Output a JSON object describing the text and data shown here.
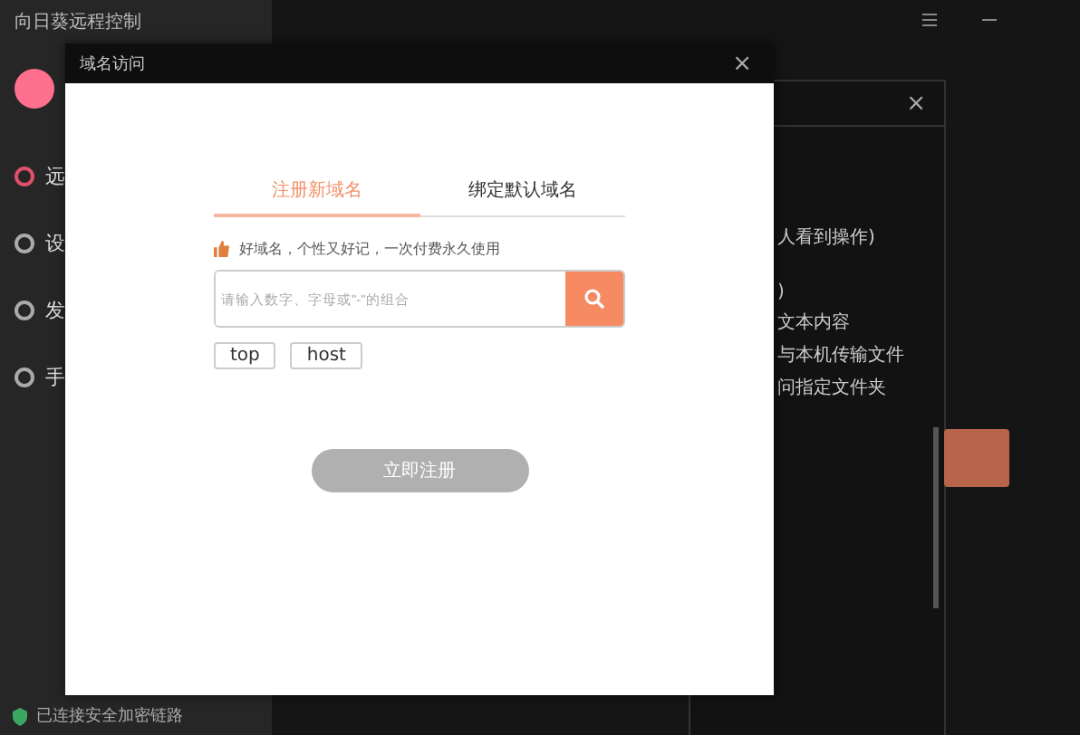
{
  "app": {
    "title": "向日葵远程控制",
    "sidebar_items": [
      "远",
      "设",
      "发",
      "手"
    ],
    "status": "已连接安全加密链路"
  },
  "back_window": {
    "close": "×",
    "lines": [
      "人看到操作)",
      ")",
      "文本内容",
      "与本机传输文件",
      "问指定文件夹"
    ]
  },
  "dialog": {
    "title": "域名访问",
    "close": "×",
    "tabs": [
      {
        "label": "注册新域名",
        "selected": true
      },
      {
        "label": "绑定默认域名",
        "selected": false
      }
    ],
    "hint": "好域名，个性又好记，一次付费永久使用",
    "search": {
      "placeholder": "请输入数字、字母或\"-\"的组合"
    },
    "suffixes": [
      "top",
      "host"
    ],
    "submit": {
      "label": "立即注册",
      "disabled": true
    }
  }
}
